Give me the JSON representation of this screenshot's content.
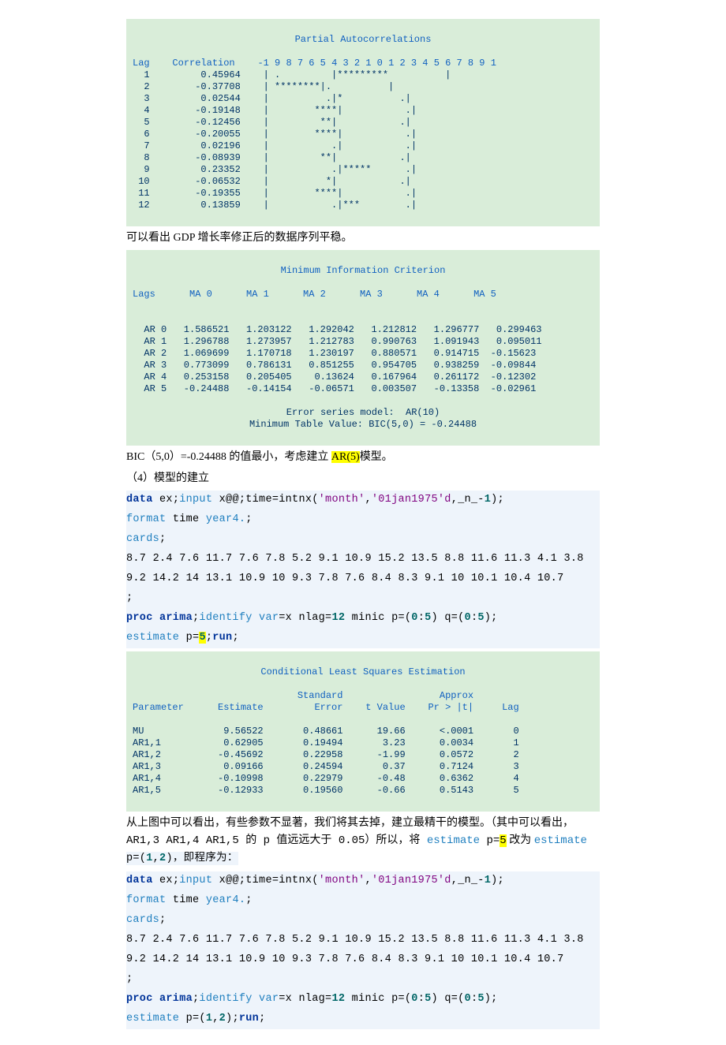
{
  "pacf": {
    "title": "Partial Autocorrelations",
    "header_lag": "Lag",
    "header_corr": "Correlation",
    "header_scale": "-1 9 8 7 6 5 4 3 2 1 0 1 2 3 4 5 6 7 8 9 1",
    "rows": [
      {
        "lag": "1",
        "corr": "0.45964",
        "bar": "| .         |*********          |"
      },
      {
        "lag": "2",
        "corr": "-0.37708",
        "bar": "| ********|.          |"
      },
      {
        "lag": "3",
        "corr": "0.02544",
        "bar": "|          .|*          .|"
      },
      {
        "lag": "4",
        "corr": "-0.19148",
        "bar": "|        ****|           .|"
      },
      {
        "lag": "5",
        "corr": "-0.12456",
        "bar": "|         **|           .|"
      },
      {
        "lag": "6",
        "corr": "-0.20055",
        "bar": "|        ****|           .|"
      },
      {
        "lag": "7",
        "corr": "0.02196",
        "bar": "|           .|           .|"
      },
      {
        "lag": "8",
        "corr": "-0.08939",
        "bar": "|         **|           .|"
      },
      {
        "lag": "9",
        "corr": "0.23352",
        "bar": "|           .|*****      .|"
      },
      {
        "lag": "10",
        "corr": "-0.06532",
        "bar": "|          *|           .|"
      },
      {
        "lag": "11",
        "corr": "-0.19355",
        "bar": "|        ****|           .|"
      },
      {
        "lag": "12",
        "corr": "0.13859",
        "bar": "|           .|***        .|"
      }
    ]
  },
  "text1": "可以看出 GDP 增长率修正后的数据序列平稳。",
  "minic": {
    "title": "Minimum Information Criterion",
    "header": "Lags      MA 0      MA 1      MA 2      MA 3      MA 4      MA 5",
    "rows": [
      "AR 0   1.586521   1.203122   1.292042   1.212812   1.296777   0.299463",
      "AR 1   1.296788   1.273957   1.212783   0.990763   1.091943   0.095011",
      "AR 2   1.069699   1.170718   1.230197   0.880571   0.914715  -0.15623",
      "AR 3   0.773099   0.786131   0.851255   0.954705   0.938259  -0.09844",
      "AR 4   0.253158   0.205405    0.13624   0.167964   0.261172  -0.12302",
      "AR 5   -0.24488   -0.14154   -0.06571   0.003507   -0.13358  -0.02961"
    ],
    "footer1": "Error series model:  AR(10)",
    "footer2": "Minimum Table Value: BIC(5,0) = -0.24488"
  },
  "text2a": "BIC（5,0）=-0.24488 的值最小，考虑建立 ",
  "text2b": "AR(5)",
  "text2c": "模型。",
  "text3": "（4）模型的建立",
  "code1": {
    "l1a": "data",
    "l1b": " ex;",
    "l1c": "input",
    "l1d": " x@@;time=intnx(",
    "l1e": "'month'",
    "l1f": ",",
    "l1g": "'01jan1975'd",
    "l1h": ",_n_-",
    "l1i": "1",
    "l1j": ");",
    "l2a": "format",
    "l2b": " time ",
    "l2c": "year4.",
    "l2d": ";",
    "l3": "cards",
    "l4": "8.7 2.4 7.6 11.7 7.6 7.8 5.2 9.1 10.9 15.2 13.5 8.8 11.6 11.3 4.1 3.8",
    "l5": "9.2 14.2 14 13.1 10.9 10 9.3 7.8 7.6 8.4 8.3 9.1 10 10.1 10.4 10.7",
    "l6": ";",
    "l7a": "proc arima",
    "l7b": ";",
    "l7c": "identify",
    "l7d": " var",
    "l7e": "=x nlag=",
    "l7f": "12",
    "l7g": " minic p=(",
    "l7h": "0",
    "l7i": ":",
    "l7j": "5",
    "l7k": ") q=(",
    "l7l": "0",
    "l7m": ":",
    "l7n": "5",
    "l7o": ");",
    "l8a": "estimate",
    "l8b": " p=",
    "l8c": "5",
    "l8d": ";",
    "l8e": "run",
    "l8f": ";"
  },
  "clse": {
    "title": "Conditional Least Squares Estimation",
    "header": "                             Standard                 Approx",
    "header2": "Parameter      Estimate         Error    t Value    Pr > |t|     Lag",
    "rows": [
      "MU              9.56522       0.48661      19.66      <.0001       0",
      "AR1,1           0.62905       0.19494       3.23      0.0034       1",
      "AR1,2          -0.45692       0.22958      -1.99      0.0572       2",
      "AR1,3           0.09166       0.24594       0.37      0.7124       3",
      "AR1,4          -0.10998       0.22979      -0.48      0.6362       4",
      "AR1,5          -0.12933       0.19560      -0.66      0.5143       5"
    ]
  },
  "text4a": "从上图中可以看出，有些参数不显著，我们将其去掉，建立最精干的模型。（其中可以看出，",
  "text4b": "AR1,3  AR1,4 AR1,5 的 p 值远远大于 0.05）所以，将 ",
  "text4c": "estimate ",
  "text4d": "p=",
  "text4e": "5",
  "text4f": " 改为 ",
  "text4g": "estimate",
  "text4h": "p=(",
  "text4i": "1",
  "text4j": ",",
  "text4k": "2",
  "text4l": ")，即程序为：",
  "code2": {
    "l8a": "estimate",
    "l8b": " p=(",
    "l8c": "1",
    "l8d": ",",
    "l8e": "2",
    "l8f": ");",
    "l8g": "run",
    "l8h": ";"
  },
  "chart_data": {
    "type": "table",
    "pacf": {
      "lag": [
        1,
        2,
        3,
        4,
        5,
        6,
        7,
        8,
        9,
        10,
        11,
        12
      ],
      "correlation": [
        0.45964,
        -0.37708,
        0.02544,
        -0.19148,
        -0.12456,
        -0.20055,
        0.02196,
        -0.08939,
        0.23352,
        -0.06532,
        -0.19355,
        0.13859
      ],
      "title": "Partial Autocorrelations"
    },
    "minic": {
      "title": "Minimum Information Criterion",
      "row_labels": [
        "AR 0",
        "AR 1",
        "AR 2",
        "AR 3",
        "AR 4",
        "AR 5"
      ],
      "col_labels": [
        "MA 0",
        "MA 1",
        "MA 2",
        "MA 3",
        "MA 4",
        "MA 5"
      ],
      "values": [
        [
          1.586521,
          1.203122,
          1.292042,
          1.212812,
          1.296777,
          0.299463
        ],
        [
          1.296788,
          1.273957,
          1.212783,
          0.990763,
          1.091943,
          0.095011
        ],
        [
          1.069699,
          1.170718,
          1.230197,
          0.880571,
          0.914715,
          -0.15623
        ],
        [
          0.773099,
          0.786131,
          0.851255,
          0.954705,
          0.938259,
          -0.09844
        ],
        [
          0.253158,
          0.205405,
          0.13624,
          0.167964,
          0.261172,
          -0.12302
        ],
        [
          -0.24488,
          -0.14154,
          -0.06571,
          0.003507,
          -0.13358,
          -0.02961
        ]
      ],
      "minimum": {
        "label": "BIC(5,0)",
        "value": -0.24488
      },
      "error_series_model": "AR(10)"
    },
    "clse": {
      "title": "Conditional Least Squares Estimation",
      "parameter": [
        "MU",
        "AR1,1",
        "AR1,2",
        "AR1,3",
        "AR1,4",
        "AR1,5"
      ],
      "estimate": [
        9.56522,
        0.62905,
        -0.45692,
        0.09166,
        -0.10998,
        -0.12933
      ],
      "std_error": [
        0.48661,
        0.19494,
        0.22958,
        0.24594,
        0.22979,
        0.1956
      ],
      "t_value": [
        19.66,
        3.23,
        -1.99,
        0.37,
        -0.48,
        -0.66
      ],
      "p_value": [
        "<.0001",
        "0.0034",
        "0.0572",
        "0.7124",
        "0.6362",
        "0.5143"
      ],
      "lag": [
        0,
        1,
        2,
        3,
        4,
        5
      ]
    }
  }
}
